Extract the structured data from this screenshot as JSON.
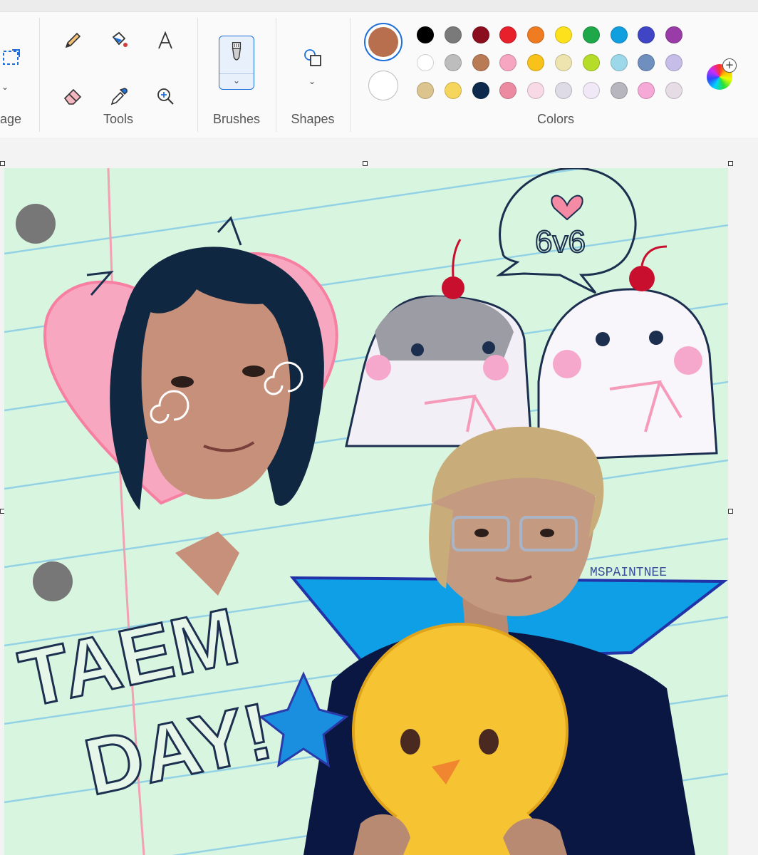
{
  "ribbon": {
    "groups": {
      "image": "age",
      "tools": "Tools",
      "brushes": "Brushes",
      "shapes": "Shapes",
      "colors": "Colors"
    }
  },
  "colors": {
    "primary": "#b86f4e",
    "secondary": "#ffffff",
    "palette": [
      [
        "#000000",
        "#7a7a7a",
        "#8b0e1e",
        "#e8202c",
        "#f07c22",
        "#fce11c",
        "#1ea84a",
        "#119fe0",
        "#3f45c5",
        "#9a3ca7"
      ],
      [
        "#ffffff",
        "#bdbdbd",
        "#b97a56",
        "#f6a6c0",
        "#f8c21b",
        "#ede4b0",
        "#b6dc2a",
        "#9cd7ea",
        "#6f8fbf",
        "#c6bde8"
      ],
      [
        "#dcc48e",
        "#f5d55c",
        "#0d2a4d",
        "#ec8aa2",
        "#f8d9e6",
        "#dedbe6",
        "#f0e8f6",
        "#b7b5bd",
        "#f6a8d6",
        "#e6dce6"
      ]
    ]
  },
  "artwork": {
    "bubble_text": "6v6",
    "title_line1": "TAEM",
    "title_line2": "DAY!",
    "signature": "MSPAINTNEE"
  }
}
